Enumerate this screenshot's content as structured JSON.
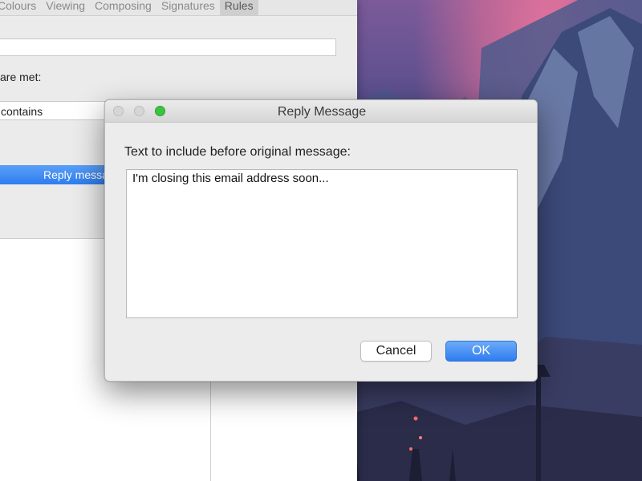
{
  "prefs_window": {
    "tabs": [
      {
        "label": "Colours"
      },
      {
        "label": "Viewing"
      },
      {
        "label": "Composing"
      },
      {
        "label": "Signatures"
      },
      {
        "label": "Rules",
        "active": true
      }
    ],
    "conditions_label": "are met:",
    "condition_operator": "contains",
    "action_selected": "Reply message"
  },
  "dialog": {
    "title": "Reply Message",
    "prompt": "Text to include before original message:",
    "message_text": "I'm closing this email address soon...",
    "cancel_label": "Cancel",
    "ok_label": "OK"
  },
  "colors": {
    "accent": "#2f7cf0",
    "zoom_button": "#3ec244"
  },
  "icons": [
    "close-icon",
    "minimize-icon",
    "zoom-icon"
  ]
}
